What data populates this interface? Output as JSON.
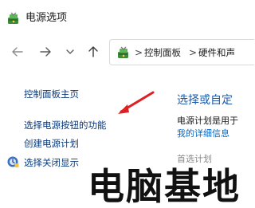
{
  "window": {
    "title": "电源选项",
    "icon": "power-options-icon"
  },
  "navigation": {
    "back_icon": "arrow-left-icon",
    "forward_icon": "arrow-right-icon",
    "recent_icon": "chevron-down-icon",
    "up_icon": "arrow-up-icon"
  },
  "address_bar": {
    "icon": "control-panel-icon",
    "separator": ">",
    "breadcrumbs": [
      "控制面板",
      "硬件和声"
    ]
  },
  "left_pane": {
    "links": [
      "控制面板主页",
      "选择电源按钮的功能",
      "创建电源计划",
      "选择关闭显示"
    ]
  },
  "content": {
    "heading": "选择或自定",
    "description": "电源计划是用于",
    "details_link": "我的详细信息",
    "partial_text": "首选计划"
  },
  "annotation": {
    "arrow_color": "#e02020"
  },
  "watermark": {
    "text": "电脑基地"
  },
  "colors": {
    "link": "#0a3a7a",
    "heading": "#1f5aa8",
    "accent_link": "#0a66c2"
  }
}
